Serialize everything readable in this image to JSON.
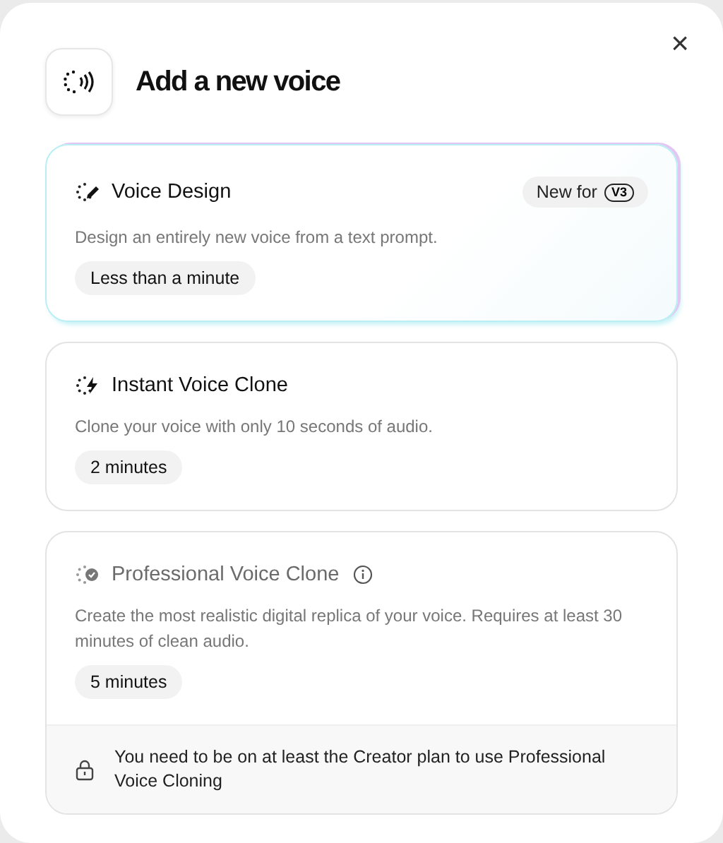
{
  "dialog": {
    "title": "Add a new voice",
    "close": "×"
  },
  "options": [
    {
      "kind": "design",
      "title": "Voice Design",
      "info": false,
      "badge": {
        "text": "New for",
        "tag": "V3"
      },
      "highlighted": true,
      "disabled": false,
      "description": "Design an entirely new voice from a text prompt.",
      "duration": "Less than a minute"
    },
    {
      "kind": "instant",
      "title": "Instant Voice Clone",
      "info": false,
      "highlighted": false,
      "disabled": false,
      "description": "Clone your voice with only 10 seconds of audio.",
      "duration": "2 minutes"
    },
    {
      "kind": "professional",
      "title": "Professional Voice Clone",
      "info": true,
      "highlighted": false,
      "disabled": true,
      "description": "Create the most realistic digital replica of your voice. Requires at least 30 minutes of clean audio.",
      "duration": "5 minutes",
      "notice": "You need to be on at least the Creator plan to use Professional Voice Cloning"
    }
  ]
}
